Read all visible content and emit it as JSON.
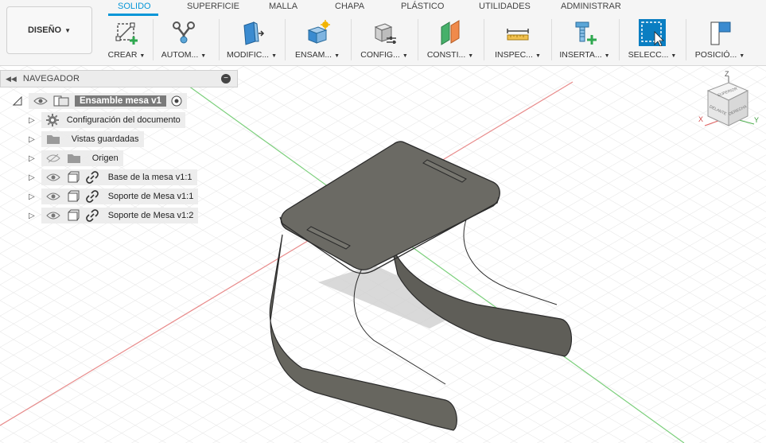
{
  "workspace": {
    "label": "DISEÑO"
  },
  "tabs": [
    "SOLIDO",
    "SUPERFICIE",
    "MALLA",
    "CHAPA",
    "PLÁSTICO",
    "UTILIDADES",
    "ADMINISTRAR"
  ],
  "active_tab": "SOLIDO",
  "tools": [
    {
      "label": "CREAR",
      "icon": "create-sketch-icon"
    },
    {
      "label": "AUTOM...",
      "icon": "automate-icon"
    },
    {
      "label": "MODIFIC...",
      "icon": "modify-icon"
    },
    {
      "label": "ENSAM...",
      "icon": "assemble-icon"
    },
    {
      "label": "CONFIG...",
      "icon": "configure-icon"
    },
    {
      "label": "CONSTI...",
      "icon": "construct-icon"
    },
    {
      "label": "INSPEC...",
      "icon": "inspect-ruler-icon"
    },
    {
      "label": "INSERTA...",
      "icon": "insert-icon"
    },
    {
      "label": "SELECC...",
      "icon": "select-icon"
    },
    {
      "label": "POSICIÓ...",
      "icon": "position-icon"
    }
  ],
  "navigator": {
    "title": "NAVEGADOR",
    "root": "Ensamble mesa v1",
    "items": [
      {
        "label": "Configuración del documento",
        "icon": "gear-icon"
      },
      {
        "label": "Vistas guardadas",
        "icon": "folder-icon"
      },
      {
        "label": "Origen",
        "icon": "folder-icon"
      },
      {
        "label": "Base de la mesa v1:1",
        "icon": "component-icon"
      },
      {
        "label": "Soporte de Mesa v1:1",
        "icon": "component-icon"
      },
      {
        "label": "Soporte de Mesa v1:2",
        "icon": "component-icon"
      }
    ]
  },
  "viewcube": {
    "z": "Z",
    "x": "X",
    "y": "Y",
    "top": "SUPERIOR",
    "front": "DELANTE",
    "right": "DERECHA"
  },
  "colors": {
    "accent": "#0696d7",
    "model": "#6b6a64",
    "model_edge": "#2b2b2b",
    "grid_axis_red": "#e88b8b",
    "grid_axis_green": "#7ccf7c"
  }
}
